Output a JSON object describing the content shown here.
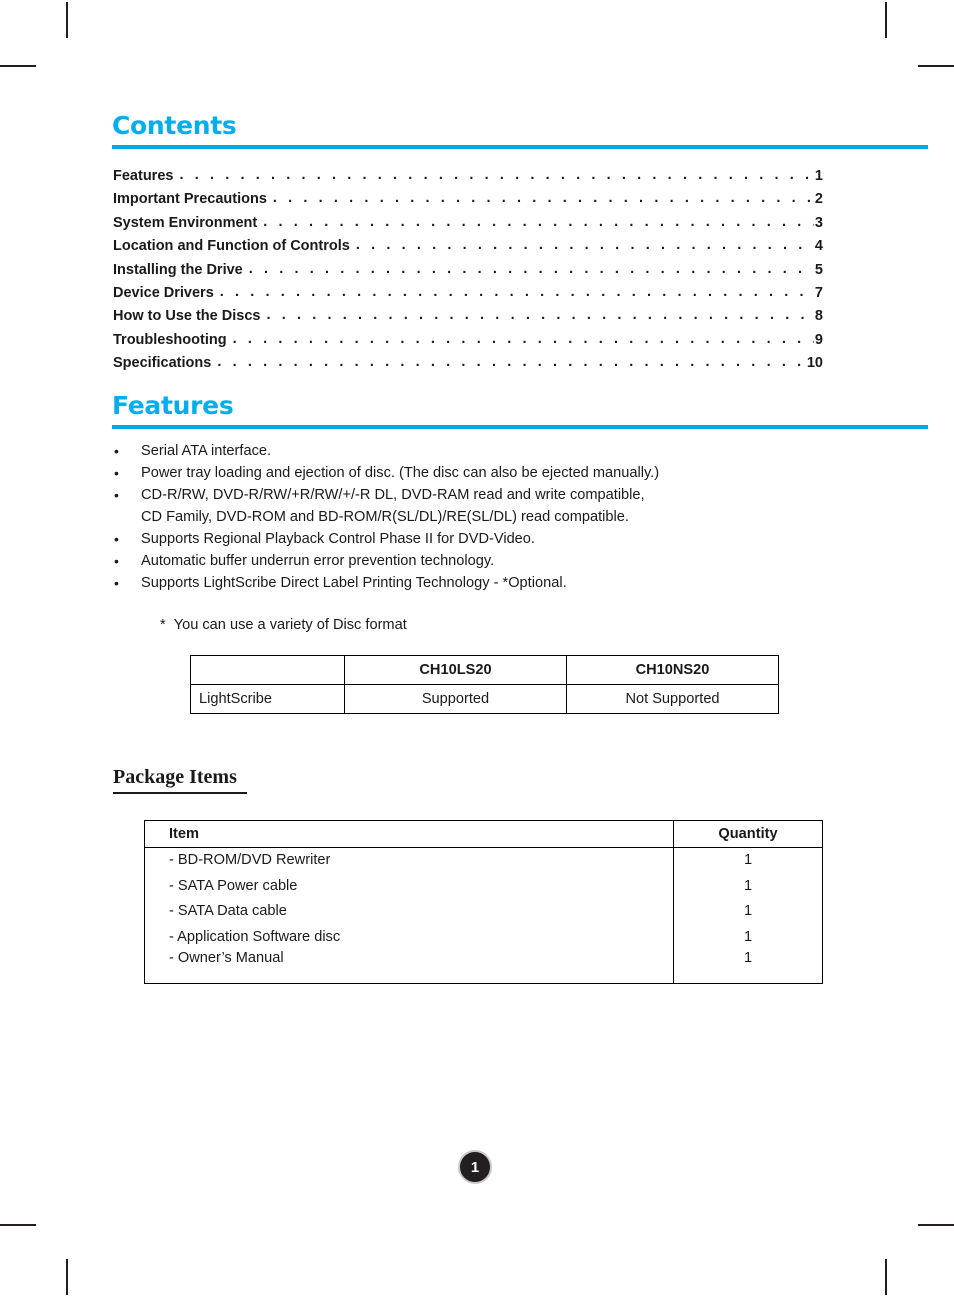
{
  "document": {
    "page_number": "1"
  },
  "contents": {
    "heading": "Contents",
    "entries": [
      {
        "label": "Features",
        "page": "1"
      },
      {
        "label": "Important Precautions",
        "page": "2"
      },
      {
        "label": "System Environment",
        "page": "3"
      },
      {
        "label": "Location and Function of Controls",
        "page": "4"
      },
      {
        "label": "Installing the Drive",
        "page": "5"
      },
      {
        "label": "Device Drivers",
        "page": "7"
      },
      {
        "label": "How to Use the Discs",
        "page": "8"
      },
      {
        "label": "Troubleshooting",
        "page": "9"
      },
      {
        "label": "Specifications",
        "page": "10"
      }
    ],
    "dot_leader": ". . . . . . . . . . . . . . . . . . . . . . . . . . . . . . . . . . . . . . . . . . . . . . . . . . . . . . . . . . . . . . . . . . . . . . . . . . . . . . . ."
  },
  "features": {
    "heading": "Features",
    "bullet_marker": "•",
    "bullets": [
      {
        "line1": "Serial ATA interface.",
        "line2": ""
      },
      {
        "line1": "Power tray loading and ejection of disc. (The disc can also be ejected manually.)",
        "line2": ""
      },
      {
        "line1": "CD-R/RW, DVD-R/RW/+R/RW/+/-R DL, DVD-RAM read and write compatible,",
        "line2": "CD Family, DVD-ROM and BD-ROM/R(SL/DL)/RE(SL/DL) read compatible."
      },
      {
        "line1": "Supports Regional Playback Control Phase II for DVD-Video.",
        "line2": ""
      },
      {
        "line1": "Automatic buffer underrun error prevention technology.",
        "line2": ""
      },
      {
        "line1": "Supports LightScribe Direct Label Printing Technology - *Optional.",
        "line2": ""
      }
    ],
    "footnote": {
      "star": "*",
      "text": "You can use a variety of Disc format"
    },
    "lightscribe_table": {
      "headers": [
        "",
        "CH10LS20",
        "CH10NS20"
      ],
      "rows": [
        [
          "LightScribe",
          "Supported",
          "Not Supported"
        ]
      ]
    }
  },
  "package_items": {
    "heading": "Package Items",
    "headers": [
      "Item",
      "Quantity"
    ],
    "rows": [
      [
        "- BD-ROM/DVD Rewriter",
        "1"
      ],
      [
        "- SATA Power cable",
        "1"
      ],
      [
        "- SATA Data cable",
        "1"
      ],
      [
        "- Application Software disc",
        "1"
      ],
      [
        "- Owner’s Manual",
        "1"
      ]
    ]
  },
  "colors": {
    "accent": "#00aeef",
    "rule": "#00a8e4",
    "text": "#1a1a1a",
    "badge_fill": "#231f20",
    "badge_ring": "#c9c9c9"
  }
}
